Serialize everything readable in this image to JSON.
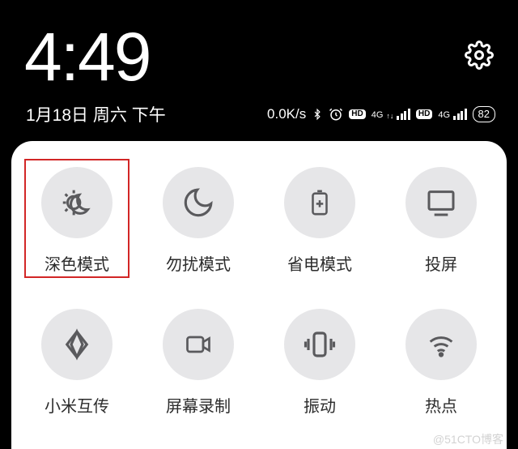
{
  "clock": "4:49",
  "date": "1月18日 周六 下午",
  "status": {
    "netspeed": "0.0K/s",
    "hd": "HD",
    "net_label": "4G",
    "battery": "82"
  },
  "tiles": [
    {
      "id": "dark-mode",
      "label": "深色模式",
      "highlight": true
    },
    {
      "id": "do-not-disturb",
      "label": "勿扰模式"
    },
    {
      "id": "power-save",
      "label": "省电模式"
    },
    {
      "id": "cast-screen",
      "label": "投屏"
    },
    {
      "id": "mi-share",
      "label": "小米互传"
    },
    {
      "id": "screen-record",
      "label": "屏幕录制"
    },
    {
      "id": "vibrate",
      "label": "振动"
    },
    {
      "id": "hotspot",
      "label": "热点"
    }
  ],
  "watermark": "@51CTO博客"
}
